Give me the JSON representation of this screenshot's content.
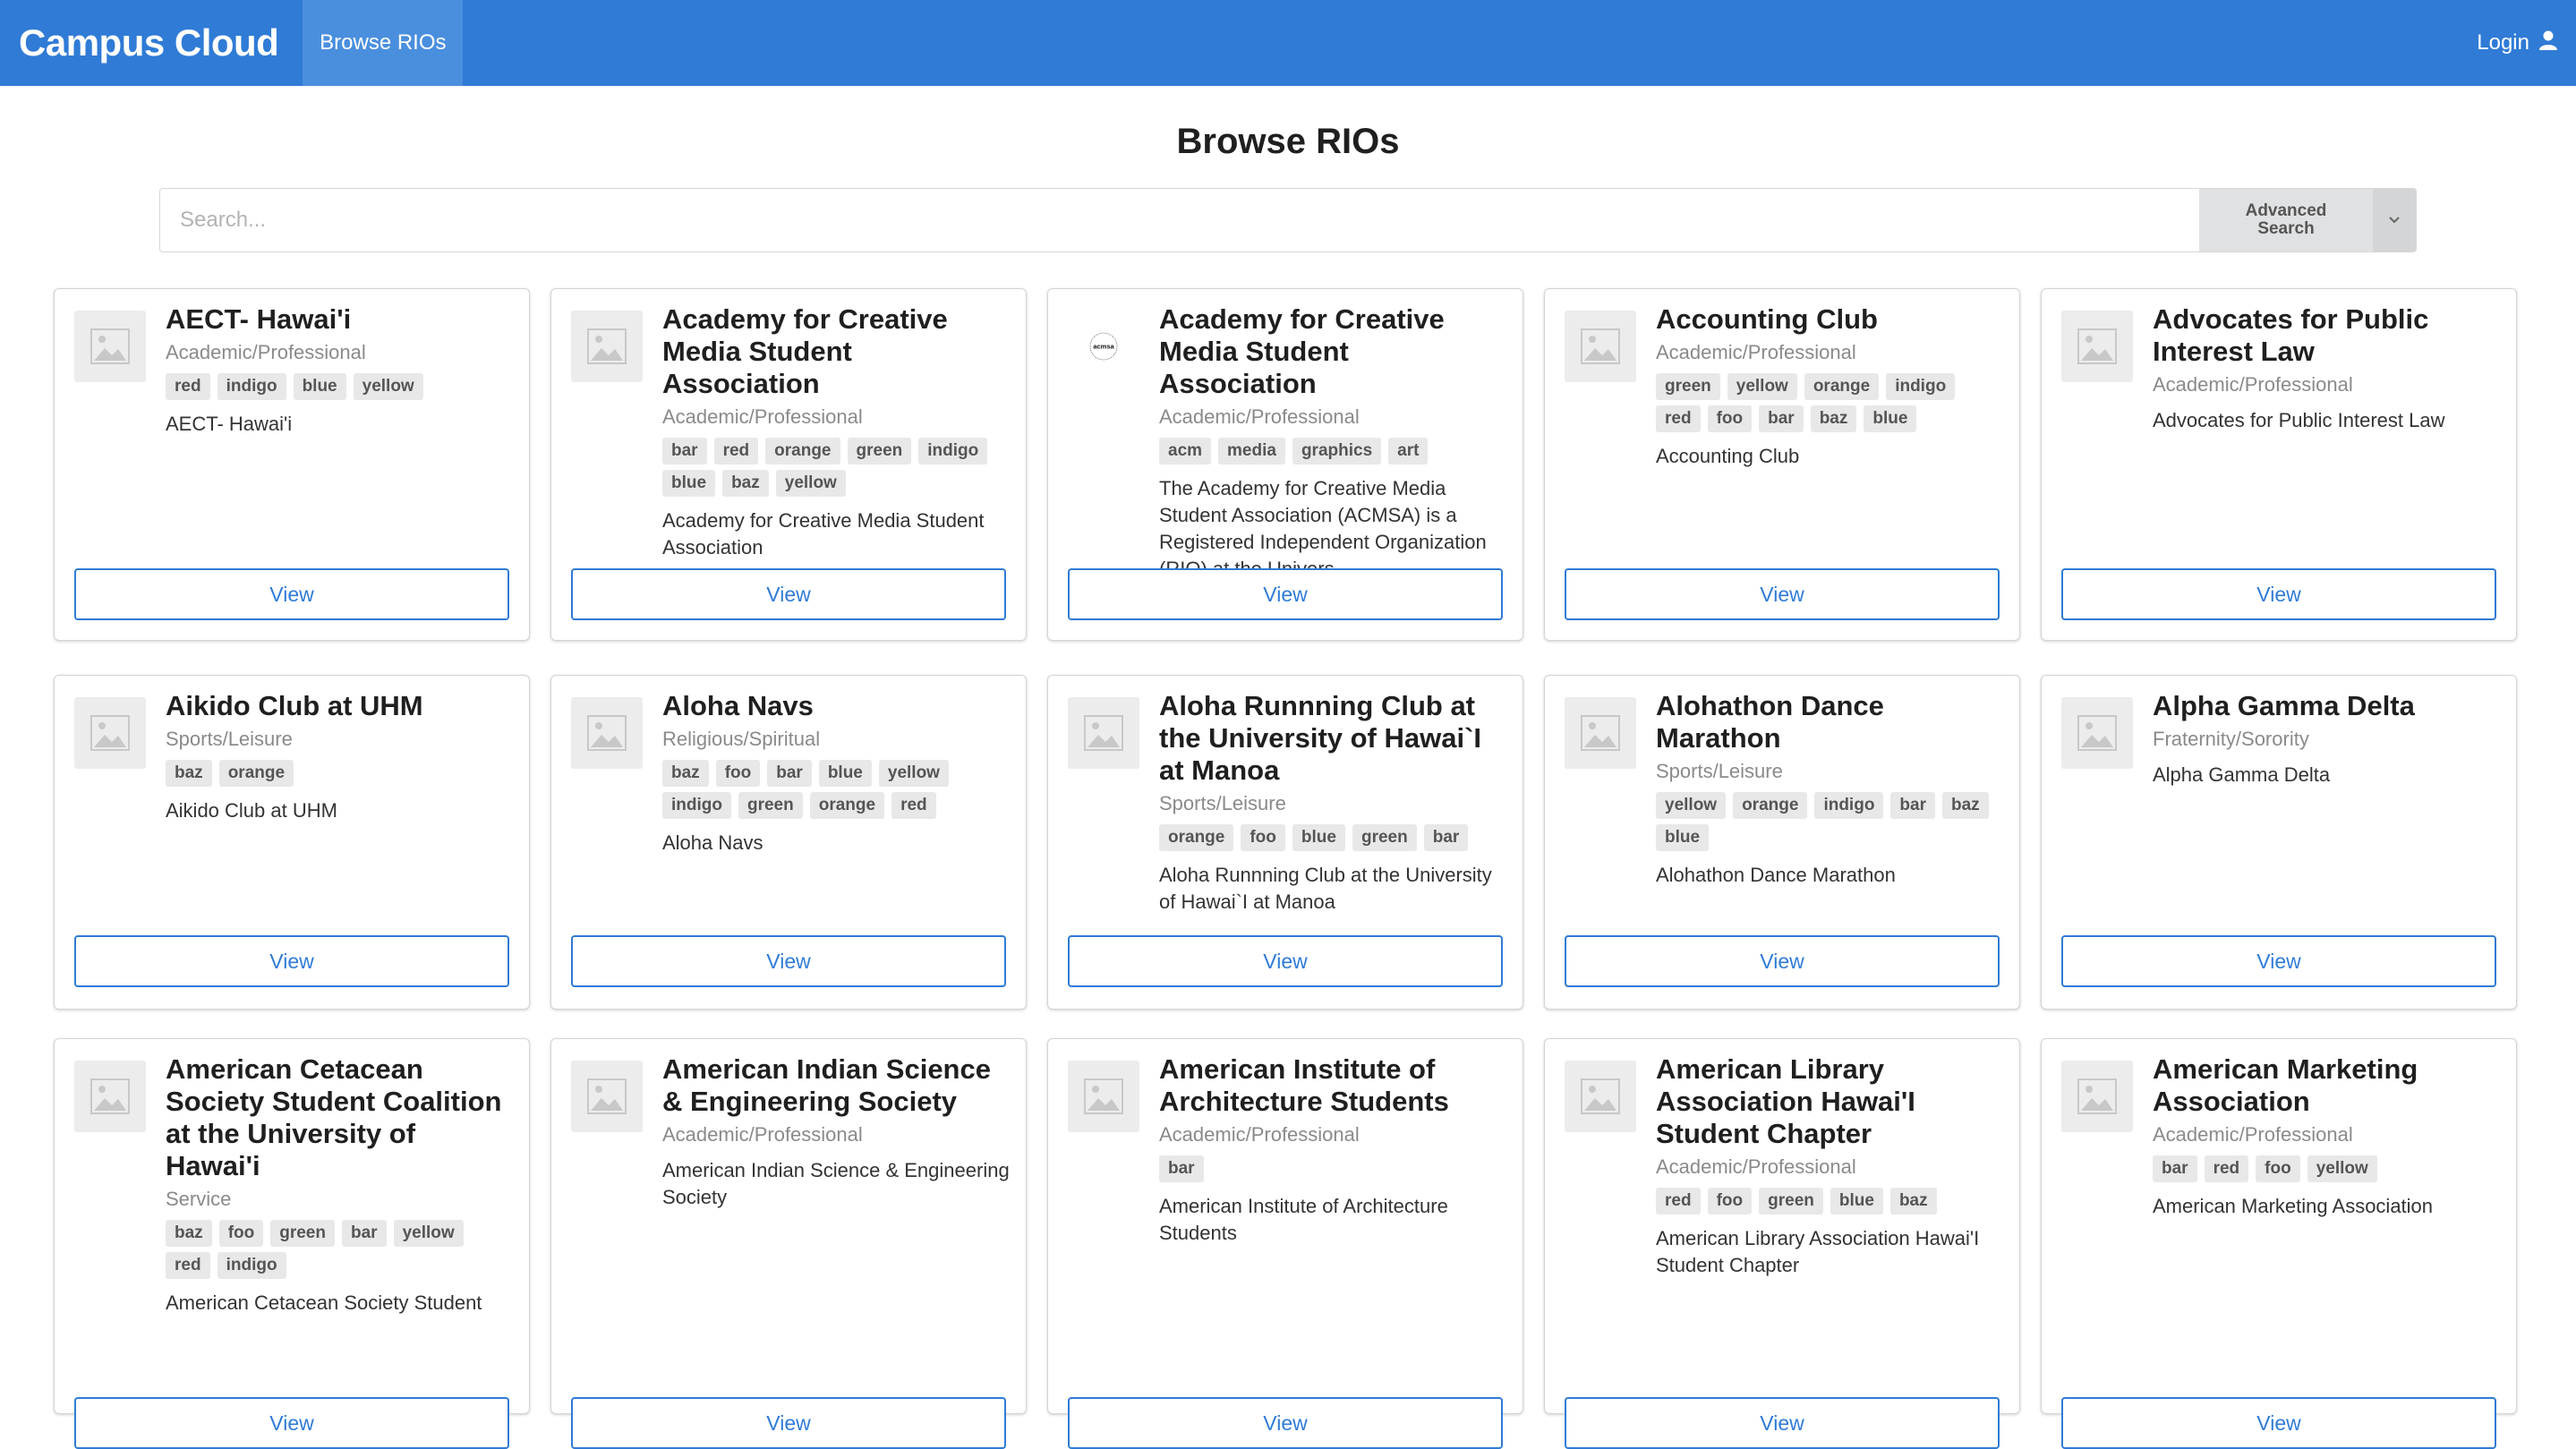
{
  "navbar": {
    "brand": "Campus Cloud",
    "tab": "Browse RIOs",
    "login": "Login"
  },
  "page": {
    "title": "Browse RIOs"
  },
  "search": {
    "placeholder": "Search...",
    "advanced_line1": "Advanced",
    "advanced_line2": "Search"
  },
  "view_label": "View",
  "cards": [
    {
      "title": "AECT- Hawai'i",
      "category": "Academic/Professional",
      "tags": [
        "red",
        "indigo",
        "blue",
        "yellow"
      ],
      "description": "AECT- Hawai'i",
      "logo": false
    },
    {
      "title": "Academy for Creative Media Student Association",
      "category": "Academic/Professional",
      "tags": [
        "bar",
        "red",
        "orange",
        "green",
        "indigo",
        "blue",
        "baz",
        "yellow"
      ],
      "description": "Academy for Creative Media Student Association",
      "logo": false
    },
    {
      "title": "Academy for Creative Media Student Association",
      "category": "Academic/Professional",
      "tags": [
        "acm",
        "media",
        "graphics",
        "art"
      ],
      "description": "The Academy for Creative Media Student Association (ACMSA) is a Registered Independent Organization (RIO) at the Univers...",
      "logo": true,
      "logo_text": "acmsa"
    },
    {
      "title": "Accounting Club",
      "category": "Academic/Professional",
      "tags": [
        "green",
        "yellow",
        "orange",
        "indigo",
        "red",
        "foo",
        "bar",
        "baz",
        "blue"
      ],
      "description": "Accounting Club",
      "logo": false
    },
    {
      "title": "Advocates for Public Interest Law",
      "category": "Academic/Professional",
      "tags": [],
      "description": "Advocates for Public Interest Law",
      "logo": false
    },
    {
      "title": "Aikido Club at UHM",
      "category": "Sports/Leisure",
      "tags": [
        "baz",
        "orange"
      ],
      "description": "Aikido Club at UHM",
      "logo": false
    },
    {
      "title": "Aloha Navs",
      "category": "Religious/Spiritual",
      "tags": [
        "baz",
        "foo",
        "bar",
        "blue",
        "yellow",
        "indigo",
        "green",
        "orange",
        "red"
      ],
      "description": "Aloha Navs",
      "logo": false
    },
    {
      "title": "Aloha Runnning Club at the University of Hawai`I at Manoa",
      "category": "Sports/Leisure",
      "tags": [
        "orange",
        "foo",
        "blue",
        "green",
        "bar"
      ],
      "description": "Aloha Runnning Club at the University of Hawai`I at Manoa",
      "logo": false
    },
    {
      "title": "Alohathon Dance Marathon",
      "category": "Sports/Leisure",
      "tags": [
        "yellow",
        "orange",
        "indigo",
        "bar",
        "baz",
        "blue"
      ],
      "description": "Alohathon Dance Marathon",
      "logo": false
    },
    {
      "title": "Alpha Gamma Delta",
      "category": "Fraternity/Sorority",
      "tags": [],
      "description": "Alpha Gamma Delta",
      "logo": false
    },
    {
      "title": "American Cetacean Society Student Coalition at the University of Hawai'i",
      "category": "Service",
      "tags": [
        "baz",
        "foo",
        "green",
        "bar",
        "yellow",
        "red",
        "indigo"
      ],
      "description": "American Cetacean Society Student",
      "logo": false
    },
    {
      "title": "American Indian Science & Engineering Society",
      "category": "Academic/Professional",
      "tags": [],
      "description": "American Indian Science & Engineering Society",
      "logo": false
    },
    {
      "title": "American Institute of Architecture Students",
      "category": "Academic/Professional",
      "tags": [
        "bar"
      ],
      "description": "American Institute of Architecture Students",
      "logo": false
    },
    {
      "title": "American Library Association Hawai'I Student Chapter",
      "category": "Academic/Professional",
      "tags": [
        "red",
        "foo",
        "green",
        "blue",
        "baz"
      ],
      "description": "American Library Association Hawai'I Student Chapter",
      "logo": false
    },
    {
      "title": "American Marketing Association",
      "category": "Academic/Professional",
      "tags": [
        "bar",
        "red",
        "foo",
        "yellow"
      ],
      "description": "American Marketing Association",
      "logo": false
    }
  ]
}
